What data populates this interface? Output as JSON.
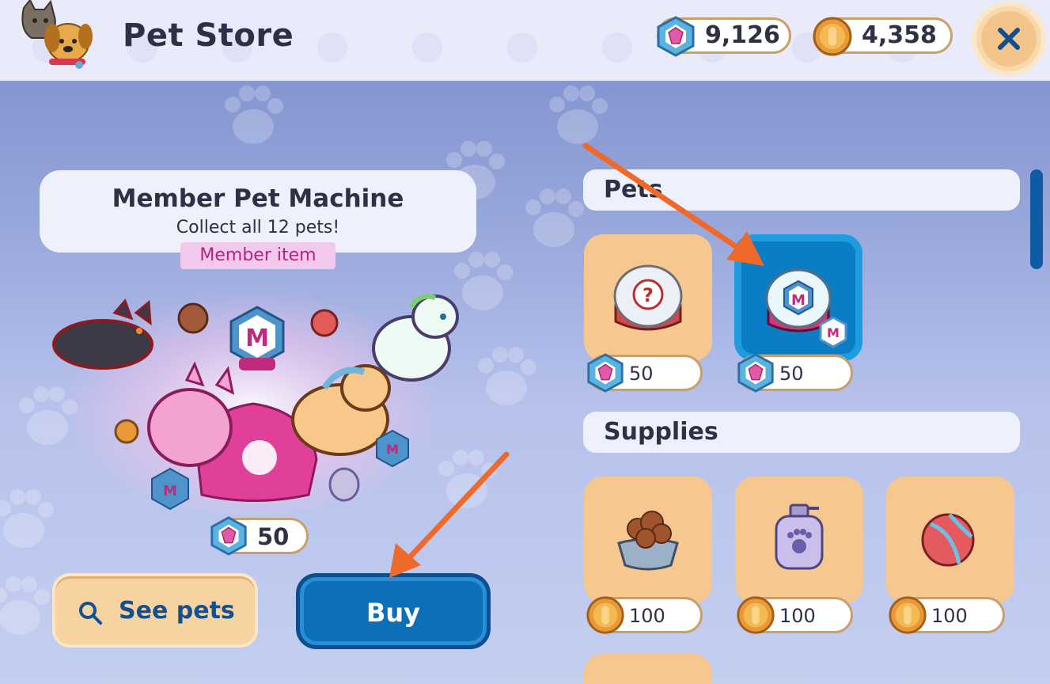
{
  "header": {
    "title": "Pet Store",
    "gems": "9,126",
    "coins": "4,358",
    "close_label": "×"
  },
  "featured": {
    "title": "Member Pet Machine",
    "subtitle": "Collect all 12 pets!",
    "tag": "Member item",
    "price": "50",
    "see_pets_label": "See pets",
    "buy_label": "Buy"
  },
  "sections": {
    "pets": {
      "label": "Pets",
      "items": [
        {
          "name": "mystery-capsule",
          "price": "50",
          "currency": "gem"
        },
        {
          "name": "member-capsule",
          "price": "50",
          "currency": "gem"
        }
      ]
    },
    "supplies": {
      "label": "Supplies",
      "items": [
        {
          "name": "pet-food-bowl",
          "price": "100",
          "currency": "coin"
        },
        {
          "name": "pet-shampoo",
          "price": "100",
          "currency": "coin"
        },
        {
          "name": "toy-ball",
          "price": "100",
          "currency": "coin"
        }
      ]
    }
  },
  "colors": {
    "accent": "#0d6fb7",
    "annotation_arrow": "#ef6a2a",
    "card": "#f6c88f"
  }
}
